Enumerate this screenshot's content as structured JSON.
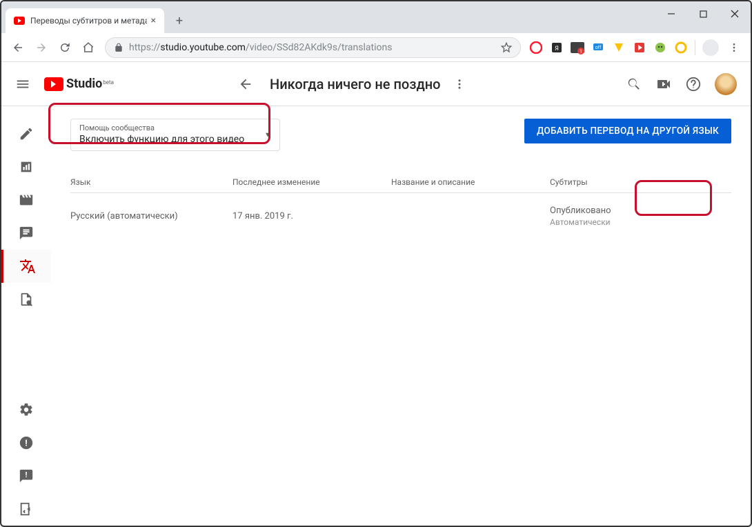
{
  "browser": {
    "tab_title": "Переводы субтитров и метадан",
    "url_host": "https://",
    "url_domain": "studio.youtube.com",
    "url_path": "/video/SSd82AKdk9s/translations"
  },
  "header": {
    "logo_text": "Studio",
    "logo_beta": "beta",
    "video_title": "Никогда ничего не поздно"
  },
  "dropdown": {
    "label": "Помощь сообщества",
    "value": "Включить функцию для этого видео"
  },
  "add_button": "ДОБАВИТЬ ПЕРЕВОД НА ДРУГОЙ ЯЗЫК",
  "table": {
    "headers": {
      "language": "Язык",
      "modified": "Последнее изменение",
      "title_desc": "Название и описание",
      "subtitles": "Субтитры"
    },
    "row": {
      "language": "Русский (автоматически)",
      "modified": "17 янв. 2019 г.",
      "title_desc": "",
      "subtitles_status": "Опубликовано",
      "subtitles_note": "Автоматически"
    }
  }
}
